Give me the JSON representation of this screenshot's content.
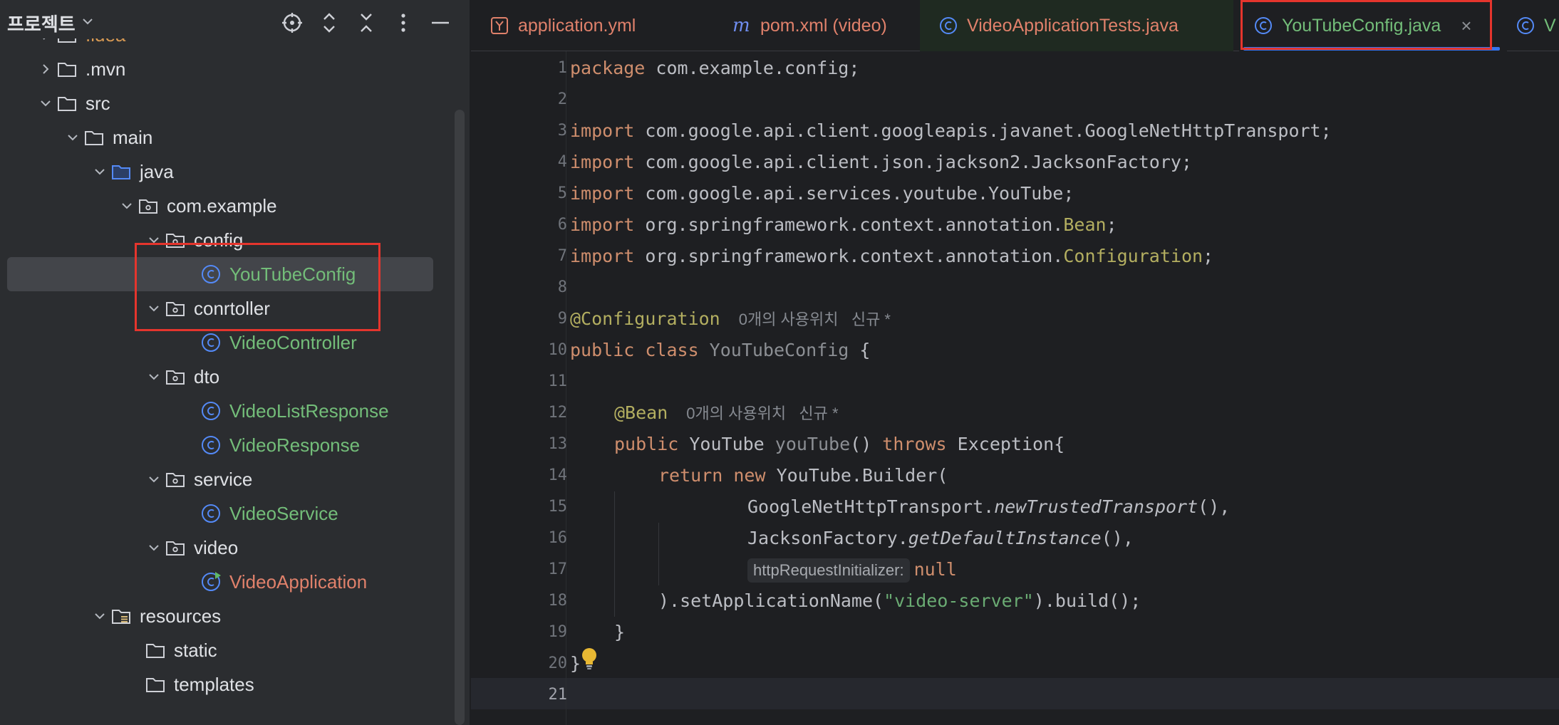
{
  "project_panel": {
    "title": "프로젝트",
    "header_icons": [
      "target-icon",
      "expand-all-icon",
      "collapse-all-icon",
      "more-icon",
      "minimize-icon"
    ],
    "tree": [
      {
        "label": ".idea",
        "kind": "folder",
        "state": "collapsed",
        "depth": 1,
        "color": "idea"
      },
      {
        "label": ".mvn",
        "kind": "folder",
        "state": "collapsed",
        "depth": 1
      },
      {
        "label": "src",
        "kind": "folder",
        "state": "expanded",
        "depth": 1
      },
      {
        "label": "main",
        "kind": "folder",
        "state": "expanded",
        "depth": 2
      },
      {
        "label": "java",
        "kind": "source-folder",
        "state": "expanded",
        "depth": 3
      },
      {
        "label": "com.example",
        "kind": "package",
        "state": "expanded",
        "depth": 4
      },
      {
        "label": "config",
        "kind": "package",
        "state": "expanded",
        "depth": 5
      },
      {
        "label": "YouTubeConfig",
        "kind": "class",
        "depth": 6,
        "selected": true
      },
      {
        "label": "conrtoller",
        "kind": "package",
        "state": "expanded",
        "depth": 5
      },
      {
        "label": "VideoController",
        "kind": "class",
        "depth": 6
      },
      {
        "label": "dto",
        "kind": "package",
        "state": "expanded",
        "depth": 5
      },
      {
        "label": "VideoListResponse",
        "kind": "class",
        "depth": 6
      },
      {
        "label": "VideoResponse",
        "kind": "class",
        "depth": 6
      },
      {
        "label": "service",
        "kind": "package",
        "state": "expanded",
        "depth": 5
      },
      {
        "label": "VideoService",
        "kind": "class",
        "depth": 6
      },
      {
        "label": "video",
        "kind": "package",
        "state": "expanded",
        "depth": 5
      },
      {
        "label": "VideoApplication",
        "kind": "app-class",
        "depth": 6
      },
      {
        "label": "resources",
        "kind": "resources-folder",
        "state": "expanded",
        "depth": 3
      },
      {
        "label": "static",
        "kind": "folder",
        "depth": 4
      },
      {
        "label": "templates",
        "kind": "folder",
        "depth": 4
      }
    ]
  },
  "tabs": [
    {
      "label": "application.yml",
      "icon": "yaml-icon"
    },
    {
      "label": "pom.xml (video)",
      "icon": "maven-icon"
    },
    {
      "label": "VideoApplicationTests.java",
      "icon": "class-icon"
    },
    {
      "label": "YouTubeConfig.java",
      "icon": "class-icon",
      "active": true,
      "close": "×"
    },
    {
      "label": "V",
      "icon": "class-icon"
    }
  ],
  "editor": {
    "line_numbers": [
      "1",
      "2",
      "3",
      "4",
      "5",
      "6",
      "7",
      "8",
      "9",
      "10",
      "11",
      "12",
      "13",
      "14",
      "15",
      "16",
      "17",
      "18",
      "19",
      "20",
      "21"
    ],
    "current_line": 21,
    "code": {
      "l1_kw": "package",
      "l1_rest": " com.example.config;",
      "l3_kw": "import",
      "l3_rest": " com.google.api.client.googleapis.javanet.GoogleNetHttpTransport;",
      "l4_kw": "import",
      "l4_rest": " com.google.api.client.json.jackson2.JacksonFactory;",
      "l5_kw": "import",
      "l5_rest": " com.google.api.services.youtube.YouTube;",
      "l6_kw": "import",
      "l6_rest": " org.springframework.context.annotation.",
      "l6_ann": "Bean",
      "l6_end": ";",
      "l7_kw": "import",
      "l7_rest": " org.springframework.context.annotation.",
      "l7_ann": "Configuration",
      "l7_end": ";",
      "l9_ann": "@Configuration",
      "l9_usage": "0개의 사용위치   신규 *",
      "l10_kw": "public class",
      "l10_name": " YouTubeConfig",
      "l10_end": " {",
      "l12_ann": "@Bean",
      "l12_usage": "0개의 사용위치   신규 *",
      "l13_kw1": "public",
      "l13_type": " YouTube ",
      "l13_name": "youTube",
      "l13_paren": "() ",
      "l13_kw2": "throws",
      "l13_end": " Exception{",
      "l14_kw": "return new",
      "l14_rest": " YouTube.Builder(",
      "l15_cls": "GoogleNetHttpTransport.",
      "l15_m": "newTrustedTransport",
      "l15_end": "(),",
      "l16_cls": "JacksonFactory.",
      "l16_m": "getDefaultInstance",
      "l16_end": "(),",
      "l17_hint": "httpRequestInitializer:",
      "l17_kw": "null",
      "l18_pre": ").setApplicationName(",
      "l18_str": "\"video-server\"",
      "l18_end": ").build();",
      "l19": "}",
      "l20": "}"
    }
  },
  "colors": {
    "keyword": "#cf8e6d",
    "annotation": "#b3ae60",
    "string": "#6aab73",
    "class_file": "#73bd79",
    "modified_file": "#e0816b",
    "accent": "#3574f0",
    "highlight_box": "#e5352d"
  }
}
